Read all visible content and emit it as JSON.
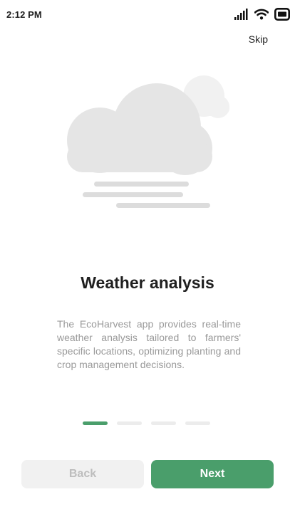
{
  "status_bar": {
    "time": "2:12 PM",
    "icons": [
      "signal-icon",
      "wifi-icon",
      "battery-icon"
    ]
  },
  "skip_label": "Skip",
  "illustration": {
    "icon": "cloudy-fog-icon"
  },
  "title": "Weather analysis",
  "description": "The EcoHarvest app provides real-time weather analysis tailored to farmers' specific locations, optimizing planting and crop management decisions.",
  "pager": {
    "total": 4,
    "active_index": 0
  },
  "buttons": {
    "back_label": "Back",
    "next_label": "Next"
  },
  "colors": {
    "accent": "#4a9e6b",
    "inactive": "#ececec",
    "muted_text": "#9a9a9a"
  }
}
